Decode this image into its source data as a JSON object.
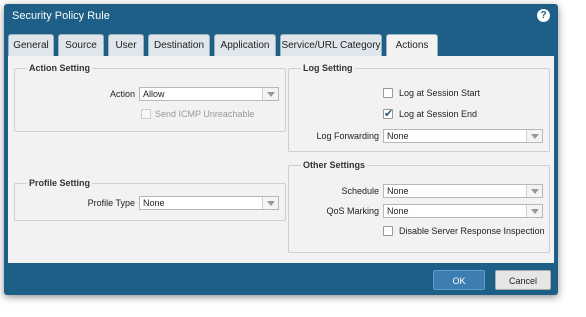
{
  "window": {
    "title": "Security Policy Rule",
    "help_icon": "?"
  },
  "tabs": [
    {
      "label": "General"
    },
    {
      "label": "Source"
    },
    {
      "label": "User"
    },
    {
      "label": "Destination"
    },
    {
      "label": "Application"
    },
    {
      "label": "Service/URL Category"
    },
    {
      "label": "Actions"
    }
  ],
  "active_tab": "Actions",
  "action_setting": {
    "title": "Action Setting",
    "action_label": "Action",
    "action_value": "Allow",
    "send_icmp_label": "Send ICMP Unreachable",
    "send_icmp_checked": false,
    "send_icmp_disabled": true
  },
  "profile_setting": {
    "title": "Profile Setting",
    "profile_type_label": "Profile Type",
    "profile_type_value": "None"
  },
  "log_setting": {
    "title": "Log Setting",
    "log_start_label": "Log at Session Start",
    "log_start_checked": false,
    "log_end_label": "Log at Session End",
    "log_end_checked": true,
    "log_forwarding_label": "Log Forwarding",
    "log_forwarding_value": "None"
  },
  "other_settings": {
    "title": "Other Settings",
    "schedule_label": "Schedule",
    "schedule_value": "None",
    "qos_label": "QoS Marking",
    "qos_value": "None",
    "disable_inspection_label": "Disable Server Response Inspection",
    "disable_inspection_checked": false
  },
  "buttons": {
    "ok": "OK",
    "cancel": "Cancel"
  },
  "check_mark": "✔",
  "colors": {
    "header": "#1d5f87",
    "ok_button": "#3c7eb0",
    "panel": "#f2f2f2"
  }
}
